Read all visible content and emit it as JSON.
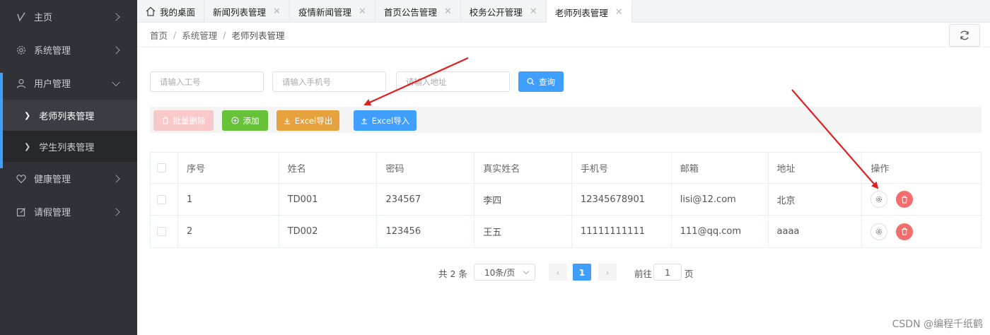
{
  "sidebar": {
    "items": [
      {
        "label": "主页",
        "icon": "check-icon"
      },
      {
        "label": "系统管理",
        "icon": "gear-icon"
      },
      {
        "label": "用户管理",
        "icon": "user-icon"
      },
      {
        "label": "健康管理",
        "icon": "heart-icon"
      },
      {
        "label": "请假管理",
        "icon": "edit-icon"
      }
    ],
    "sub_items": [
      {
        "label": "老师列表管理",
        "active": true
      },
      {
        "label": "学生列表管理",
        "active": false
      }
    ]
  },
  "tabs": [
    {
      "label": "我的桌面"
    },
    {
      "label": "新闻列表管理"
    },
    {
      "label": "疫情新闻管理"
    },
    {
      "label": "首页公告管理"
    },
    {
      "label": "校务公开管理"
    },
    {
      "label": "老师列表管理",
      "active": true
    }
  ],
  "breadcrumb": [
    "首页",
    "系统管理",
    "老师列表管理"
  ],
  "filters": {
    "job_no_placeholder": "请输入工号",
    "phone_placeholder": "请输入手机号",
    "address_placeholder": "请输入地址",
    "query_label": "查询"
  },
  "toolbar": {
    "batch_delete": "批量删除",
    "add": "添加",
    "excel_export": "Excel导出",
    "excel_import": "Excel导入"
  },
  "table": {
    "columns": [
      "序号",
      "姓名",
      "密码",
      "真实姓名",
      "手机号",
      "邮箱",
      "地址",
      "操作"
    ],
    "rows": [
      [
        "1",
        "TD001",
        "234567",
        "李四",
        "12345678901",
        "lisi@12.com",
        "北京"
      ],
      [
        "2",
        "TD002",
        "123456",
        "王五",
        "11111111111",
        "111@qq.com",
        "aaaa"
      ]
    ]
  },
  "pagination": {
    "total": "共 2 条",
    "page_size": "10条/页",
    "current_page": "1",
    "goto_label": "前往",
    "goto_value": "1",
    "page_unit": "页"
  },
  "watermark": "CSDN @编程千纸鹤",
  "colors": {
    "sidebar_bg": "#2f3237",
    "primary": "#409eff",
    "success": "#67c23a",
    "warning": "#e6a23c",
    "danger": "#f56c6c",
    "annotation_arrow": "#e02020"
  }
}
